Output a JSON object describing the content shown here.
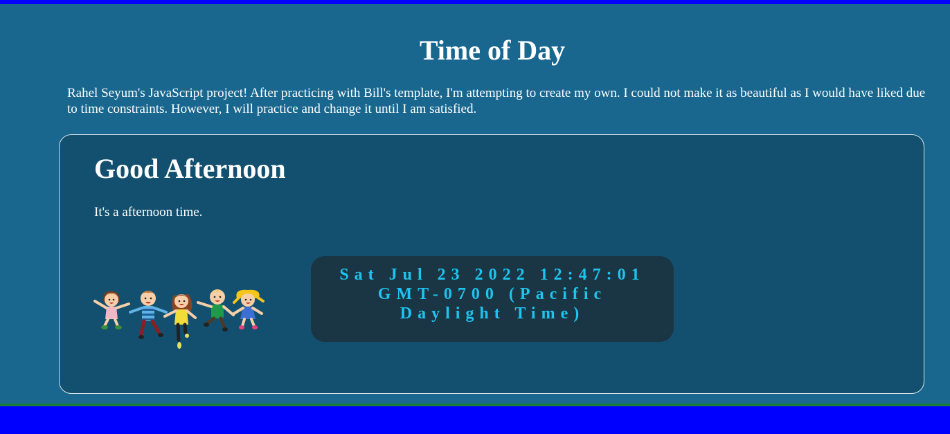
{
  "page": {
    "title": "Time of Day",
    "intro": "Rahel Seyum's JavaScript project! After practicing with Bill's template, I'm attempting to create my own. I could not make it as beautiful as I would have liked due to time constraints. However, I will practice and change it until I am satisfied."
  },
  "card": {
    "greeting": "Good Afternoon",
    "message": "It's a afternoon time.",
    "image_icon": "jumping-kids-illustration",
    "clock": "Sat Jul 23 2022 12:47:01 GMT-0700 (Pacific Daylight Time)"
  },
  "colors": {
    "page_background": "#19678f",
    "card_background": "#13506f",
    "clock_background": "#1a3644",
    "clock_text": "#1ec4f0",
    "top_bottom_bar": "#0000ff",
    "bottom_line": "#1b7a3c"
  }
}
